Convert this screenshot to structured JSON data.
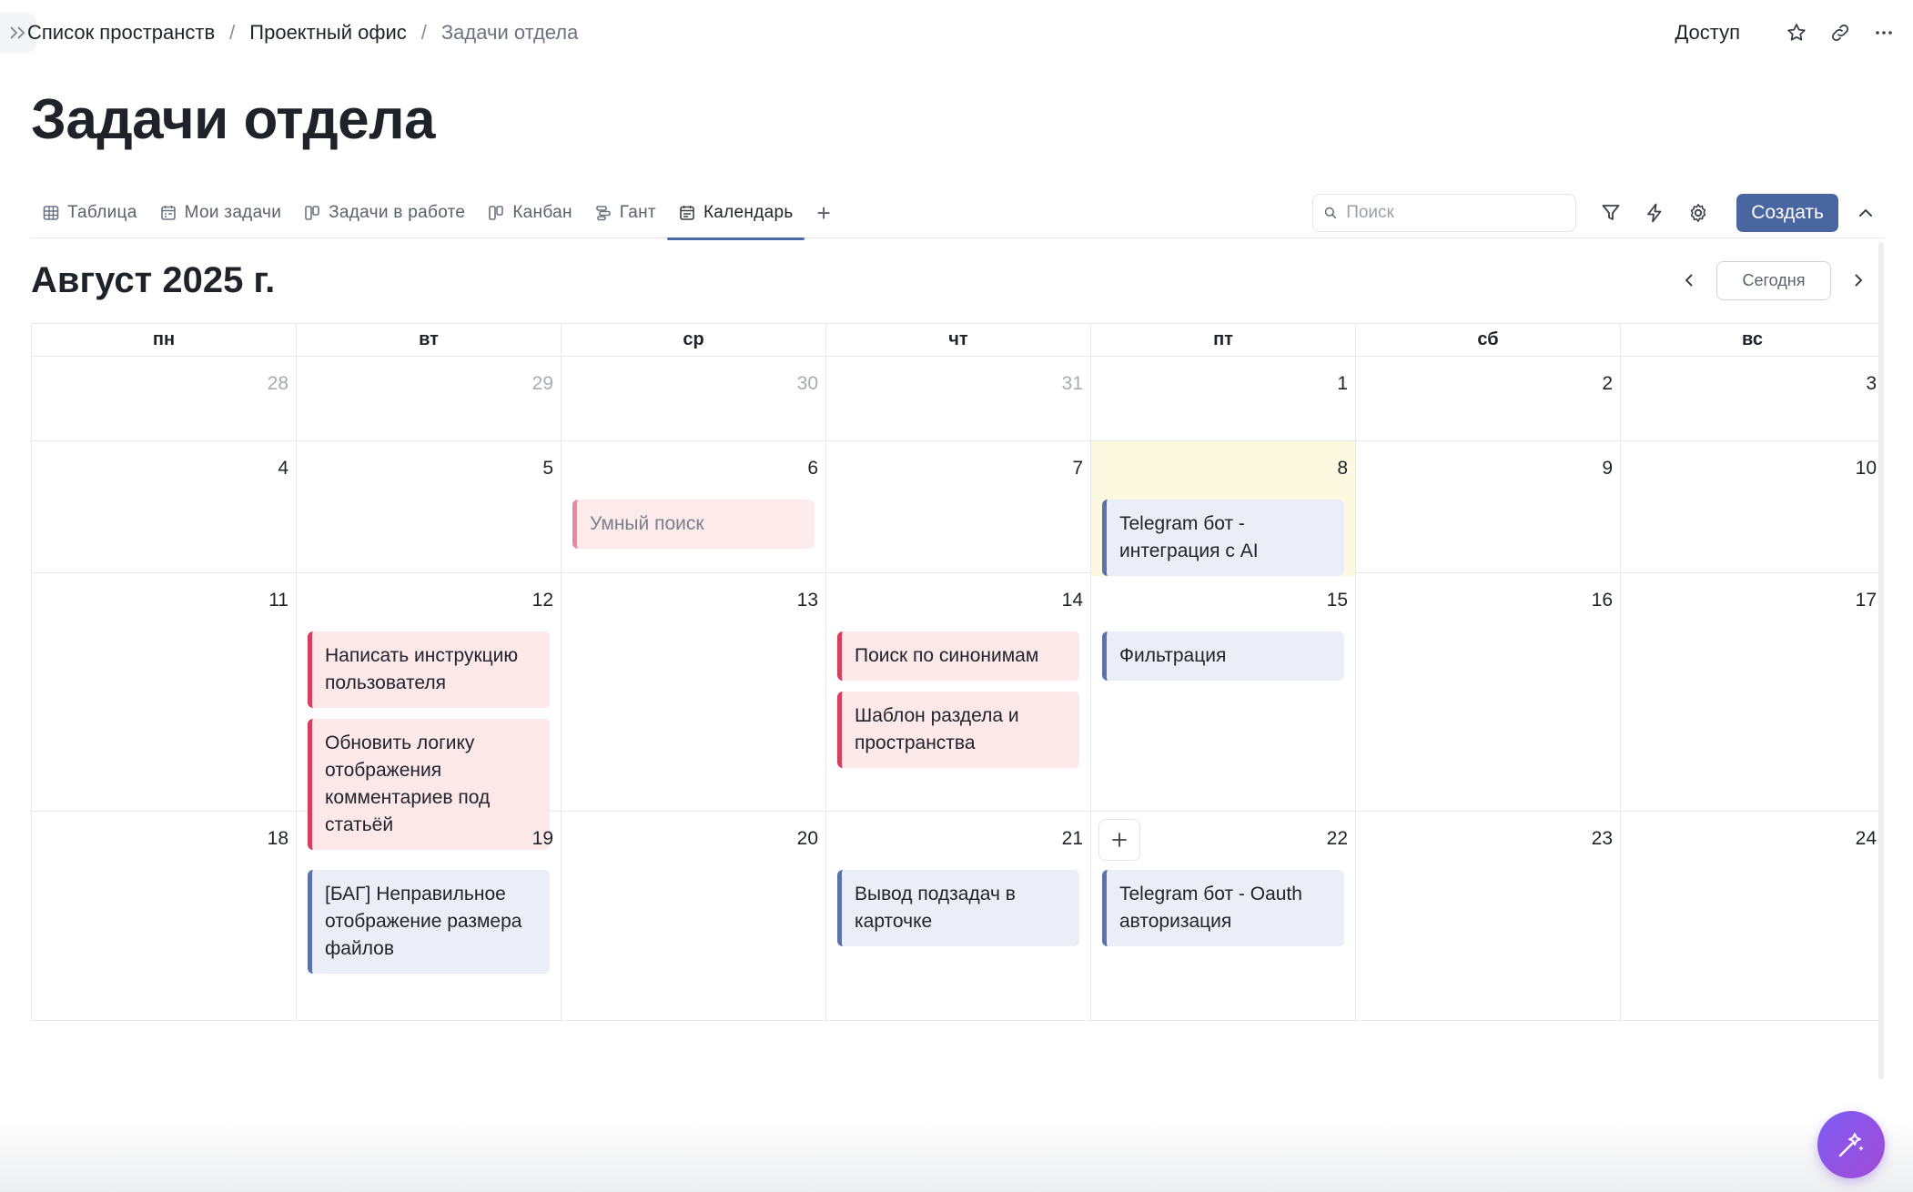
{
  "breadcrumb": [
    {
      "label": "Список пространств"
    },
    {
      "label": "Проектный офис"
    },
    {
      "label": "Задачи отдела"
    }
  ],
  "breadcrumb_separator": "/",
  "top_actions": {
    "access_label": "Доступ",
    "icons": [
      "star-icon",
      "link-icon",
      "more-icon"
    ]
  },
  "page_title": "Задачи отдела",
  "tabs": [
    {
      "label": "Таблица",
      "icon": "table-icon",
      "active": false
    },
    {
      "label": "Мои задачи",
      "icon": "calendar-list-icon",
      "active": false
    },
    {
      "label": "Задачи в работе",
      "icon": "board-icon",
      "active": false
    },
    {
      "label": "Канбан",
      "icon": "board-icon",
      "active": false
    },
    {
      "label": "Гант",
      "icon": "gantt-icon",
      "active": false
    },
    {
      "label": "Календарь",
      "icon": "calendar-icon",
      "active": true
    }
  ],
  "tab_add_label": "+",
  "search": {
    "placeholder": "Поиск",
    "value": ""
  },
  "create_label": "Создать",
  "calendar": {
    "month_title": "Август 2025 г.",
    "today_label": "Сегодня",
    "weekdays": [
      "пн",
      "вт",
      "ср",
      "чт",
      "пт",
      "сб",
      "вс"
    ],
    "weeks": [
      {
        "days": [
          {
            "num": "28",
            "other": true,
            "events": []
          },
          {
            "num": "29",
            "other": true,
            "events": []
          },
          {
            "num": "30",
            "other": true,
            "events": []
          },
          {
            "num": "31",
            "other": true,
            "events": []
          },
          {
            "num": "1",
            "events": []
          },
          {
            "num": "2",
            "events": []
          },
          {
            "num": "3",
            "events": []
          }
        ]
      },
      {
        "days": [
          {
            "num": "4",
            "events": []
          },
          {
            "num": "5",
            "events": []
          },
          {
            "num": "6",
            "events": [
              {
                "title": "Умный поиск",
                "color": "red-faded"
              }
            ]
          },
          {
            "num": "7",
            "events": []
          },
          {
            "num": "8",
            "highlight": true,
            "events": [
              {
                "title": "Telegram бот - интеграция с AI",
                "color": "blue"
              }
            ]
          },
          {
            "num": "9",
            "events": []
          },
          {
            "num": "10",
            "events": []
          }
        ]
      },
      {
        "days": [
          {
            "num": "11",
            "events": []
          },
          {
            "num": "12",
            "events": [
              {
                "title": "Написать инструкцию пользователя",
                "color": "red"
              },
              {
                "title": "Обновить логику отображения комментариев под статьёй",
                "color": "red"
              }
            ]
          },
          {
            "num": "13",
            "events": []
          },
          {
            "num": "14",
            "events": [
              {
                "title": "Поиск по синонимам",
                "color": "red"
              },
              {
                "title": "Шаблон раздела и пространства",
                "color": "red"
              }
            ]
          },
          {
            "num": "15",
            "events": [
              {
                "title": "Фильтрация",
                "color": "blue"
              }
            ]
          },
          {
            "num": "16",
            "events": []
          },
          {
            "num": "17",
            "events": []
          }
        ]
      },
      {
        "days": [
          {
            "num": "18",
            "events": []
          },
          {
            "num": "19",
            "events": [
              {
                "title": "[БАГ] Неправильное отображение размера файлов",
                "color": "blue"
              }
            ]
          },
          {
            "num": "20",
            "events": []
          },
          {
            "num": "21",
            "events": [
              {
                "title": "Вывод подзадач в карточке",
                "color": "blue"
              }
            ]
          },
          {
            "num": "22",
            "add_button": true,
            "events": [
              {
                "title": "Telegram бот - Oauth авторизация",
                "color": "blue"
              }
            ]
          },
          {
            "num": "23",
            "events": []
          },
          {
            "num": "24",
            "events": []
          }
        ]
      }
    ]
  },
  "colors": {
    "accent": "#4a66a0",
    "event_red": "#d93d5a",
    "event_blue": "#5b73ad",
    "today_bg": "#fdf9e1"
  }
}
